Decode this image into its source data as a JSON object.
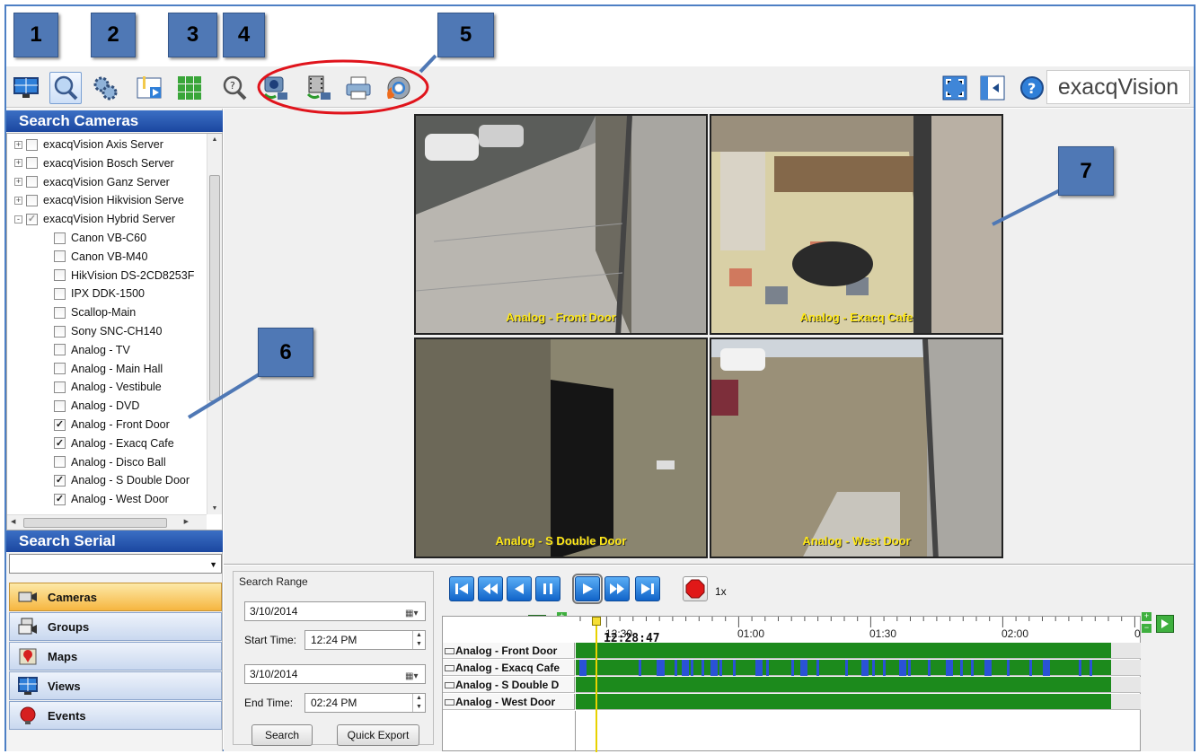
{
  "callouts": [
    "1",
    "2",
    "3",
    "4",
    "5",
    "6",
    "7"
  ],
  "toolbar": {
    "buttons": [
      "live-view-icon",
      "search-icon",
      "configuration-icon",
      "playback-export-icon",
      "multi-view-icon",
      "find-icon",
      "export-snapshot-icon",
      "export-video-icon",
      "print-icon",
      "burn-disc-icon"
    ],
    "right_buttons": [
      "fullscreen-icon",
      "panel-toggle-icon",
      "help-icon"
    ],
    "brand": "exacqVision"
  },
  "left_panel": {
    "search_cameras_title": "Search Cameras",
    "tree": [
      {
        "label": "exacqVision Axis Server",
        "level": 0,
        "checked": false,
        "expander": "+"
      },
      {
        "label": "exacqVision Bosch Server",
        "level": 0,
        "checked": false,
        "expander": "+"
      },
      {
        "label": "exacqVision Ganz Server",
        "level": 0,
        "checked": false,
        "expander": "+"
      },
      {
        "label": "exacqVision Hikvision Serve",
        "level": 0,
        "checked": false,
        "expander": "+"
      },
      {
        "label": "exacqVision Hybrid Server",
        "level": 0,
        "checked": true,
        "expander": "-"
      },
      {
        "label": "Canon VB-C60",
        "level": 1,
        "checked": false
      },
      {
        "label": "Canon VB-M40",
        "level": 1,
        "checked": false
      },
      {
        "label": "HikVision DS-2CD8253F",
        "level": 1,
        "checked": false
      },
      {
        "label": "IPX DDK-1500",
        "level": 1,
        "checked": false
      },
      {
        "label": "Scallop-Main",
        "level": 1,
        "checked": false
      },
      {
        "label": "Sony SNC-CH140",
        "level": 1,
        "checked": false
      },
      {
        "label": "Analog - TV",
        "level": 1,
        "checked": false
      },
      {
        "label": "Analog - Main Hall",
        "level": 1,
        "checked": false
      },
      {
        "label": "Analog - Vestibule",
        "level": 1,
        "checked": false
      },
      {
        "label": "Analog - DVD",
        "level": 1,
        "checked": false
      },
      {
        "label": "Analog - Front Door",
        "level": 1,
        "checked": true
      },
      {
        "label": "Analog - Exacq Cafe",
        "level": 1,
        "checked": true
      },
      {
        "label": "Analog - Disco Ball",
        "level": 1,
        "checked": false
      },
      {
        "label": "Analog - S Double Door",
        "level": 1,
        "checked": true
      },
      {
        "label": "Analog - West Door",
        "level": 1,
        "checked": true
      }
    ],
    "search_serial_title": "Search Serial",
    "serial_value": "",
    "nav": [
      "Cameras",
      "Groups",
      "Maps",
      "Views",
      "Events"
    ]
  },
  "video": {
    "tiles": [
      "Analog - Front Door",
      "Analog - Exacq Cafe",
      "Analog - S Double Door",
      "Analog - West Door"
    ]
  },
  "search_range": {
    "legend": "Search Range",
    "start_date": "3/10/2014",
    "start_time_label": "Start Time:",
    "start_time": "12:24 PM",
    "end_date": "3/10/2014",
    "end_time_label": "End Time:",
    "end_time": "02:24 PM",
    "search_button": "Search",
    "quick_export_button": "Quick Export"
  },
  "playback": {
    "speed": "1x",
    "current_time": "12:28:47",
    "ticks": [
      "12:30",
      "01:00",
      "01:30",
      "02:00",
      "0"
    ],
    "tracks": [
      "Analog - Front Door",
      "Analog - Exacq Cafe",
      "Analog - S Double D",
      "Analog - West Door"
    ]
  },
  "colors": {
    "accent": "#2a5db0",
    "track_green": "#1c8a1c",
    "motion_blue": "#2a52d6",
    "label_yellow": "#ffe818",
    "callout_red": "#e0141c"
  }
}
